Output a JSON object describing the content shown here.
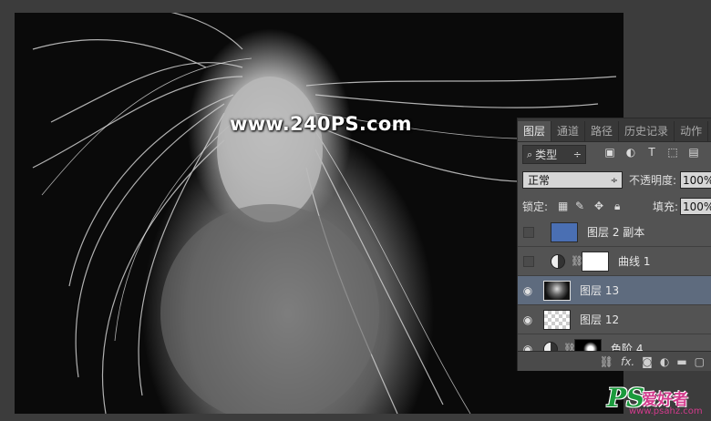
{
  "watermark": "www.240PS.com",
  "layers_panel": {
    "tabs": [
      "图层",
      "通道",
      "路径",
      "历史记录",
      "动作"
    ],
    "active_tab": 0,
    "filter": {
      "icon": "search-icon",
      "label": "类型",
      "arrow": "÷"
    },
    "filter_icons": [
      "image-filter-icon",
      "adjustment-filter-icon",
      "type-filter-icon",
      "shape-filter-icon",
      "smart-object-filter-icon"
    ],
    "blend_mode": "正常",
    "opacity_label": "不透明度:",
    "opacity_value": "100%",
    "lock_label": "锁定:",
    "fill_label": "填充:",
    "fill_value": "100%",
    "layers": [
      {
        "name": "图层 2 副本",
        "visible": false,
        "thumb": "blue",
        "selected": false
      },
      {
        "name": "曲线 1",
        "visible": false,
        "thumb": "adjust-curves",
        "selected": false
      },
      {
        "name": "图层 13",
        "visible": true,
        "thumb": "photo",
        "selected": true
      },
      {
        "name": "图层 12",
        "visible": true,
        "thumb": "transparent",
        "selected": false
      },
      {
        "name": "色阶 4",
        "visible": true,
        "thumb": "adjust-levels",
        "selected": false
      }
    ],
    "bottom_icons": [
      "link-icon",
      "fx-icon",
      "mask-icon",
      "adjustment-icon",
      "folder-icon",
      "new-layer-icon"
    ],
    "fx_label": "fx."
  },
  "logo": {
    "ps": "PS",
    "cn": "爱好者",
    "url": "www.psahz.com"
  },
  "colors": {
    "selected_row": "#5e6b7e",
    "blue_layer": "#4a6fb3",
    "logo_green": "#1a9a3c",
    "logo_pink": "#d23a8c"
  }
}
